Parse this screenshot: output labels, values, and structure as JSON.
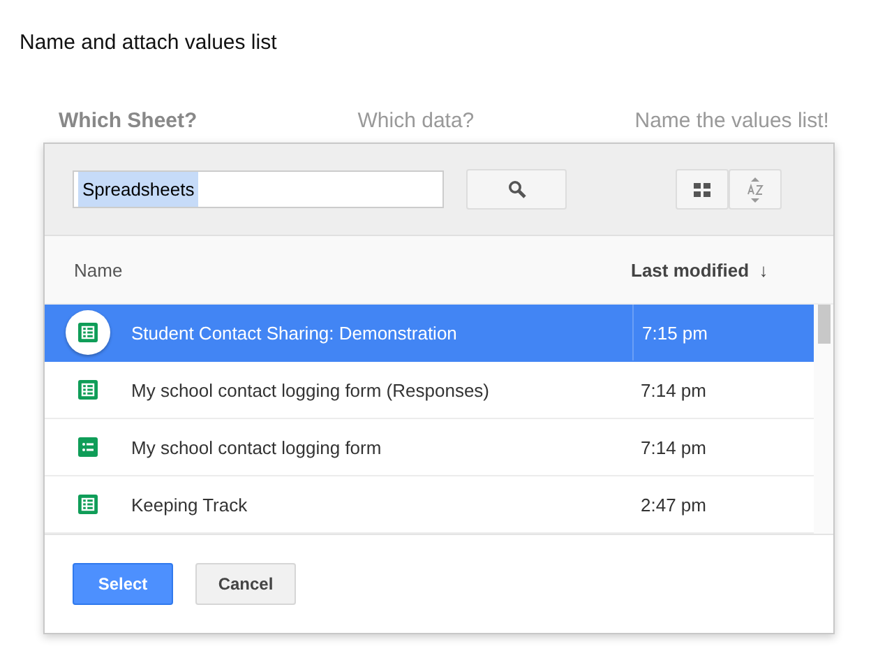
{
  "heading": "Name and attach values list",
  "steps": [
    {
      "label": "Which Sheet?",
      "selected": true
    },
    {
      "label": "Which data?",
      "selected": false
    },
    {
      "label": "Name the values list!",
      "selected": false
    }
  ],
  "search": {
    "value": "Spreadsheets"
  },
  "columns": {
    "name": "Name",
    "modified": "Last modified",
    "sort_arrow": "↓"
  },
  "rows": [
    {
      "name": "Student Contact Sharing: Demonstration",
      "modified": "7:15 pm",
      "kind": "sheet",
      "selected": true
    },
    {
      "name": "My school contact logging form (Responses)",
      "modified": "7:14 pm",
      "kind": "sheet",
      "selected": false
    },
    {
      "name": "My school contact logging form",
      "modified": "7:14 pm",
      "kind": "form",
      "selected": false
    },
    {
      "name": "Keeping Track",
      "modified": "2:47 pm",
      "kind": "sheet",
      "selected": false
    }
  ],
  "buttons": {
    "select": "Select",
    "cancel": "Cancel"
  }
}
